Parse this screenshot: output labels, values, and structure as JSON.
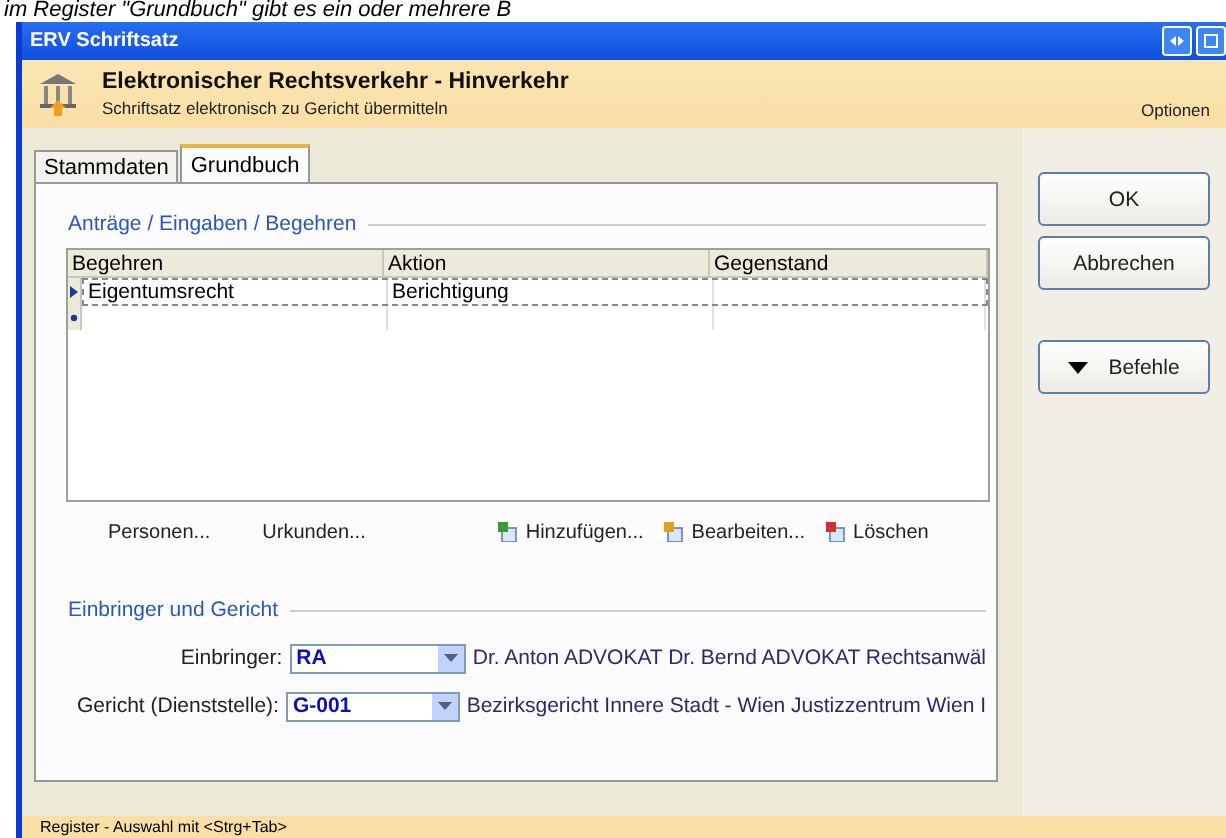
{
  "caption": "im Register \"Grundbuch\" gibt es ein oder mehrere B",
  "window": {
    "title": "ERV Schriftsatz"
  },
  "header": {
    "title": "Elektronischer Rechtsverkehr - Hinverkehr",
    "subtitle": "Schriftsatz elektronisch zu Gericht übermitteln",
    "options": "Optionen"
  },
  "tabs": [
    {
      "label": "Stammdaten",
      "selected": false
    },
    {
      "label": "Grundbuch",
      "selected": true
    }
  ],
  "requests": {
    "title": "Anträge / Eingaben / Begehren",
    "columns": [
      "Begehren",
      "Aktion",
      "Gegenstand"
    ],
    "rows": [
      {
        "kind": "current",
        "selected": true,
        "cells": [
          "Eigentumsrecht",
          "Berichtigung"
        ]
      },
      {
        "kind": "new",
        "selected": false
      }
    ],
    "left_actions": [
      "Personen...",
      "Urkunden..."
    ],
    "actions": [
      {
        "kind": "add",
        "label": "Hinzufügen..."
      },
      {
        "kind": "edit",
        "label": "Bearbeiten..."
      },
      {
        "kind": "delete",
        "label": "Löschen"
      }
    ]
  },
  "submitter": {
    "title": "Einbringer und Gericht",
    "fields": [
      {
        "label": "Einbringer:",
        "value": "RA",
        "description": "Dr. Anton ADVOKAT Dr. Bernd ADVOKAT Rechtsanwäl"
      },
      {
        "label": "Gericht (Dienststelle):",
        "value": "G-001",
        "description": "Bezirksgericht Innere Stadt - Wien Justizzentrum Wien I"
      }
    ]
  },
  "buttons": [
    {
      "kind": "plain",
      "label": "OK"
    },
    {
      "kind": "plain",
      "label": "Abbrechen"
    },
    {
      "kind": "menu",
      "label": "Befehle"
    }
  ],
  "status_bar": "Register - Auswahl mit <Strg+Tab>"
}
